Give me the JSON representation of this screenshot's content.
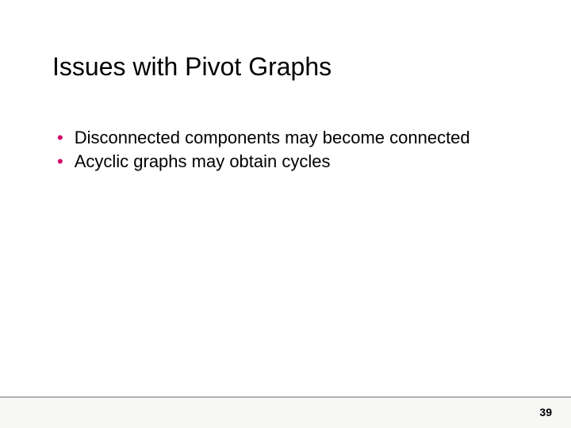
{
  "slide": {
    "title": "Issues with Pivot Graphs",
    "bullets": [
      "Disconnected components may become connected",
      "Acyclic graphs may obtain cycles"
    ],
    "page_number": "39"
  }
}
